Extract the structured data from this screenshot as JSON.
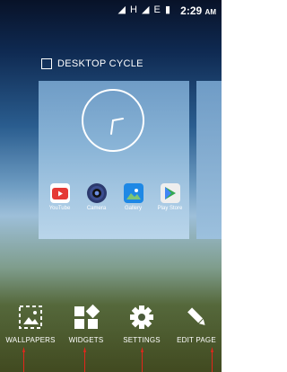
{
  "status_bar": {
    "time": "2:29",
    "ampm": "AM",
    "network_glyphs": "◢ H ◢ E ▮"
  },
  "desktop_cycle": {
    "label": "DESKTOP CYCLE",
    "checked": false
  },
  "apps": [
    {
      "label": "YouTube",
      "icon": "youtube-icon",
      "color": "#e53935"
    },
    {
      "label": "Camera",
      "icon": "camera-icon",
      "color": "#3b4d8f"
    },
    {
      "label": "Gallery",
      "icon": "gallery-icon",
      "color": "#1e88e5"
    },
    {
      "label": "Play Store",
      "icon": "play-store-icon",
      "color": "#ffffff"
    }
  ],
  "bottom_actions": [
    {
      "label": "WALLPAPERS",
      "icon": "wallpaper-icon"
    },
    {
      "label": "WIDGETS",
      "icon": "widgets-icon"
    },
    {
      "label": "SETTINGS",
      "icon": "settings-gear-icon"
    },
    {
      "label": "EDIT PAGE",
      "icon": "pencil-icon"
    }
  ],
  "colors": {
    "arrow": "#e3261b",
    "accent_white": "#ffffff"
  }
}
